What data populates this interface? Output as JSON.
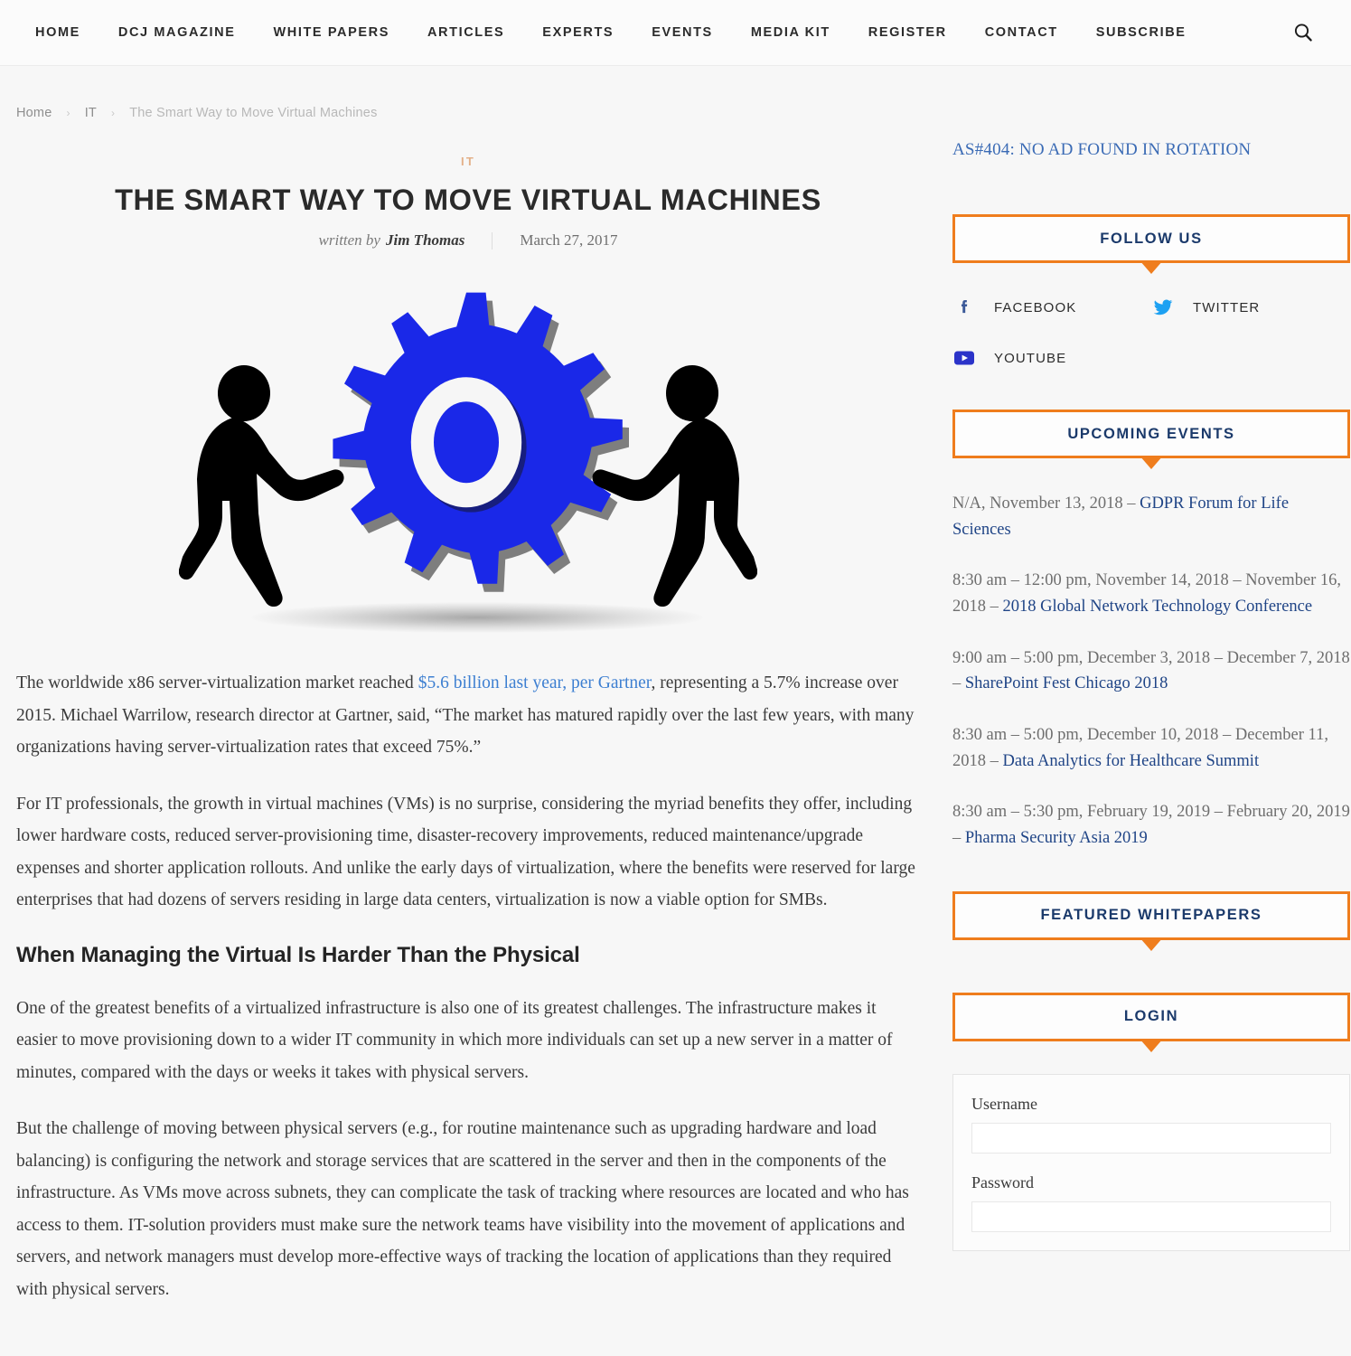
{
  "nav": {
    "items": [
      {
        "label": "HOME"
      },
      {
        "label": "DCJ MAGAZINE"
      },
      {
        "label": "WHITE PAPERS"
      },
      {
        "label": "ARTICLES"
      },
      {
        "label": "EXPERTS"
      },
      {
        "label": "EVENTS"
      },
      {
        "label": "MEDIA KIT"
      },
      {
        "label": "REGISTER"
      },
      {
        "label": "CONTACT"
      },
      {
        "label": "SUBSCRIBE"
      }
    ],
    "search_icon": "search-icon"
  },
  "breadcrumb": {
    "home": "Home",
    "section": "IT",
    "current": "The Smart Way to Move Virtual Machines",
    "separator": "›"
  },
  "article": {
    "category": "IT",
    "title": "THE SMART WAY TO MOVE VIRTUAL MACHINES",
    "written_by": "written by",
    "author": "Jim Thomas",
    "date": "March 27, 2017",
    "featured_image_alt": "two people pushing a blue gear",
    "paragraphs": {
      "p1_a": "The worldwide x86 server-virtualization market reached ",
      "p1_link": "$5.6 billion last year, per Gartner",
      "p1_b": ", representing a 5.7% increase over 2015. Michael Warrilow, research director at Gartner, said, “The market has matured rapidly over the last few years, with many organizations having server-virtualization rates that exceed 75%.”",
      "p2": "For IT professionals, the growth in virtual machines (VMs) is no surprise, considering the myriad benefits they offer, including lower hardware costs, reduced server-provisioning time, disaster-recovery improvements, reduced maintenance/upgrade expenses and shorter application rollouts. And unlike the early days of virtualization, where the benefits were reserved for large enterprises that had dozens of servers residing in large data centers, virtualization is now a viable option for SMBs.",
      "h2": "When Managing the Virtual Is Harder Than the Physical",
      "p3": "One of the greatest benefits of a virtualized infrastructure is also one of its greatest challenges. The infrastructure makes it easier to move provisioning down to a wider IT community in which more individuals can set up a new server in a matter of minutes, compared with the days or weeks it takes with physical servers.",
      "p4": "But the challenge of moving between physical servers (e.g., for routine maintenance such as upgrading hardware and load balancing) is configuring the network and storage services that are scattered in the server and then in the components of the infrastructure. As VMs move across subnets, they can complicate the task of tracking where resources are located and who has access to them. IT-solution providers must make sure the network teams have visibility into the movement of applications and servers, and network managers must develop more-effective ways of tracking the location of applications than they required with physical servers."
    }
  },
  "sidebar": {
    "ad_notice": "AS#404: NO AD FOUND IN ROTATION",
    "follow_us": {
      "title": "FOLLOW US",
      "items": [
        {
          "label": "FACEBOOK",
          "icon": "facebook-icon"
        },
        {
          "label": "TWITTER",
          "icon": "twitter-icon"
        },
        {
          "label": "YOUTUBE",
          "icon": "youtube-icon"
        }
      ]
    },
    "upcoming_events": {
      "title": "UPCOMING EVENTS",
      "items": [
        {
          "when": "N/A, November 13, 2018 – ",
          "name": "GDPR Forum for Life Sciences"
        },
        {
          "when": "8:30 am – 12:00 pm, November 14, 2018 – November 16, 2018 – ",
          "name": "2018 Global Network Technology Conference"
        },
        {
          "when": "9:00 am – 5:00 pm, December 3, 2018 – December 7, 2018 – ",
          "name": "SharePoint Fest Chicago 2018"
        },
        {
          "when": "8:30 am – 5:00 pm, December 10, 2018 – December 11, 2018 – ",
          "name": "Data Analytics for Healthcare Summit"
        },
        {
          "when": "8:30 am – 5:30 pm, February 19, 2019 – February 20, 2019 – ",
          "name": "Pharma Security Asia 2019"
        }
      ]
    },
    "featured_whitepapers": {
      "title": "FEATURED WHITEPAPERS"
    },
    "login": {
      "title": "LOGIN",
      "username_label": "Username",
      "username_value": "",
      "password_label": "Password",
      "password_value": ""
    }
  },
  "colors": {
    "accent_orange": "#ef7d1d",
    "widget_title_navy": "#1b3a6b",
    "link_blue": "#3d7fd1",
    "event_link_navy": "#1f4486",
    "category_tan": "#e3b088",
    "gear_blue": "#1a28e8",
    "page_bg": "#f7f7f7"
  }
}
